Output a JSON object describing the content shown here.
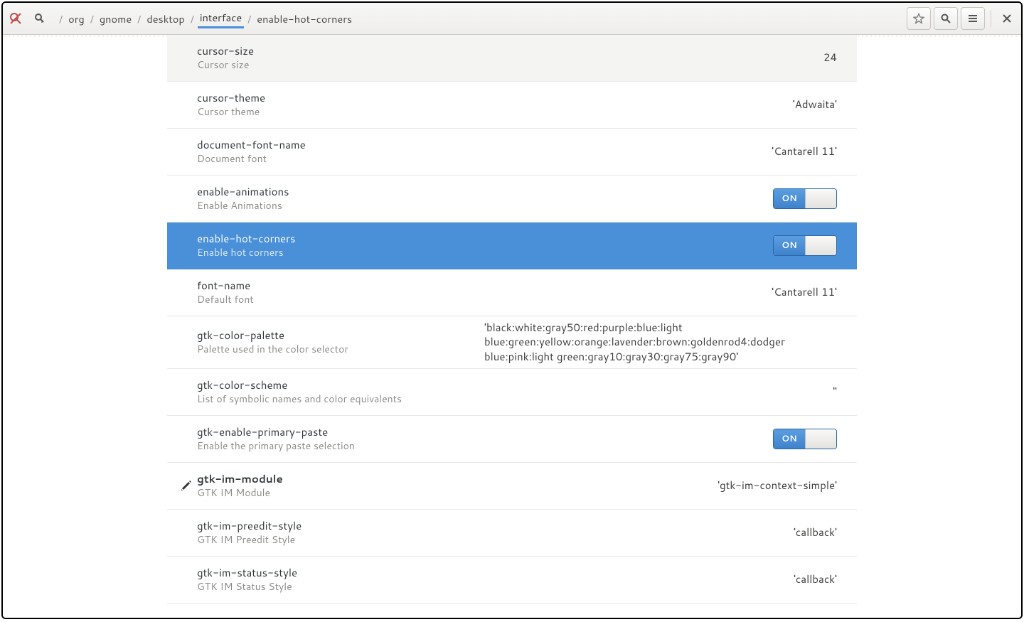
{
  "breadcrumb": [
    "org",
    "gnome",
    "desktop",
    "interface",
    "enable-hot-corners"
  ],
  "breadcrumb_active_index": 3,
  "switch_on_label": "ON",
  "rows": [
    {
      "key": "cursor-size",
      "desc": "Cursor size",
      "value": "24",
      "type": "text",
      "hover": true
    },
    {
      "key": "cursor-theme",
      "desc": "Cursor theme",
      "value": "'Adwaita'",
      "type": "text"
    },
    {
      "key": "document-font-name",
      "desc": "Document font",
      "value": "'Cantarell 11'",
      "type": "text"
    },
    {
      "key": "enable-animations",
      "desc": "Enable Animations",
      "value": "ON",
      "type": "switch"
    },
    {
      "key": "enable-hot-corners",
      "desc": "Enable hot corners",
      "value": "ON",
      "type": "switch",
      "selected": true
    },
    {
      "key": "font-name",
      "desc": "Default font",
      "value": "'Cantarell 11'",
      "type": "text"
    },
    {
      "key": "gtk-color-palette",
      "desc": "Palette used in the color selector",
      "value": "'black:white:gray50:red:purple:blue:light blue:green:yellow:orange:lavender:brown:goldenrod4:dodger blue:pink:light green:gray10:gray30:gray75:gray90'",
      "type": "text",
      "multiline": true
    },
    {
      "key": "gtk-color-scheme",
      "desc": "List of symbolic names and color equivalents",
      "value": "''",
      "type": "text"
    },
    {
      "key": "gtk-enable-primary-paste",
      "desc": "Enable the primary paste selection",
      "value": "ON",
      "type": "switch"
    },
    {
      "key": "gtk-im-module",
      "desc": "GTK IM Module",
      "value": "'gtk-im-context-simple'",
      "type": "text",
      "modified": true
    },
    {
      "key": "gtk-im-preedit-style",
      "desc": "GTK IM Preedit Style",
      "value": "'callback'",
      "type": "text"
    },
    {
      "key": "gtk-im-status-style",
      "desc": "GTK IM Status Style",
      "value": "'callback'",
      "type": "text"
    }
  ]
}
